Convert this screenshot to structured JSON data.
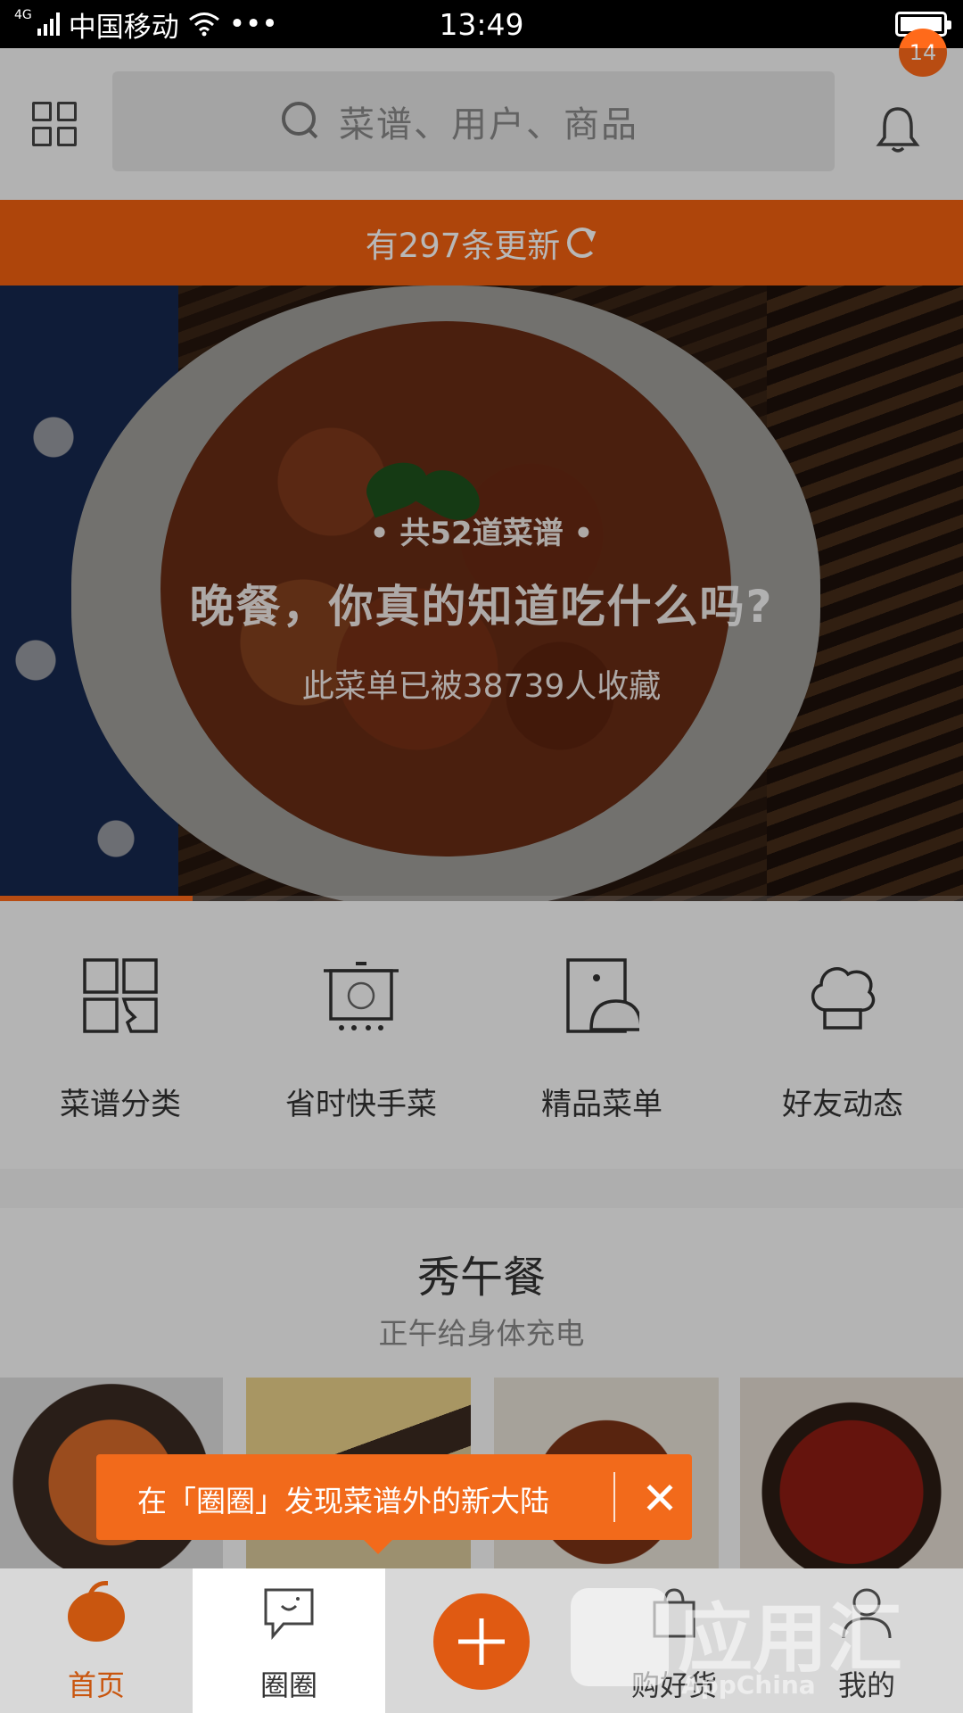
{
  "status_bar": {
    "network": "4G",
    "carrier": "中国移动",
    "more": "•••",
    "time": "13:49",
    "battery_level": 1.0
  },
  "header": {
    "search_placeholder": "菜谱、用户、商品",
    "notification_count": "14"
  },
  "update_strip": {
    "text": "有297条更新"
  },
  "banner": {
    "count_text": "• 共52道菜谱 •",
    "title": "晚餐，你真的知道吃什么吗?",
    "subtitle": "此菜单已被38739人收藏",
    "progress": 0.2
  },
  "quick_menu": [
    {
      "label": "菜谱分类",
      "icon": "category-grid-icon"
    },
    {
      "label": "省时快手菜",
      "icon": "pot-timer-icon"
    },
    {
      "label": "精品菜单",
      "icon": "menu-cloche-icon"
    },
    {
      "label": "好友动态",
      "icon": "chef-hat-icon"
    }
  ],
  "section": {
    "title": "秀午餐",
    "subtitle": "正午给身体充电"
  },
  "tooltip": {
    "text": "在「圈圈」发现菜谱外的新大陆"
  },
  "tabbar": [
    {
      "label": "首页",
      "icon": "home-tomato-icon"
    },
    {
      "label": "圈圈",
      "icon": "chat-bubble-icon"
    },
    {
      "label": "",
      "icon": "add-icon"
    },
    {
      "label": "购好货",
      "icon": "shopping-bag-icon"
    },
    {
      "label": "我的",
      "icon": "user-icon"
    }
  ],
  "watermark": {
    "text": "应用汇",
    "sub": "AppChina"
  },
  "colors": {
    "accent": "#f16010",
    "active_tab": "#c9560f"
  }
}
